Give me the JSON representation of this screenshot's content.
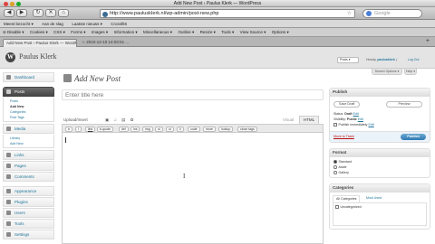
{
  "window": {
    "title": "Add New Post ‹ Paulus Klerk — WordPress"
  },
  "nav": {
    "back": "◀",
    "forward": "▶",
    "reload": "↻",
    "stop": "✕",
    "home": "⌂",
    "url": "http://www.pauluskIerk.nl/wp-admin/post-new.php",
    "search_placeholder": "Google"
  },
  "bookmarks": [
    "Meest bezocht ▾",
    "Aan de slag",
    "Laatste nieuws ▾",
    "Crossfit6"
  ],
  "devbar": [
    "⊘ Disable ▾",
    "Cookies ▾",
    "CSS ▾",
    "Forms ▾",
    "Images ▾",
    "Information ▾",
    "Miscellaneous ▾",
    "Outline ▾",
    "Resize ▾",
    "Tools ▾",
    "View Source ▾",
    "Options ▾"
  ],
  "tabs": {
    "active": "Add New Post ‹ Paulus Klerk — WordPress",
    "second": "☆ 2010-12-10 14:03:51 ..."
  },
  "wp": {
    "site_name": "Paulus Klerk",
    "posts_dropdown": "Posts ▾",
    "howdy_prefix": "Howdy,",
    "username": "pauluskIerk",
    "logout": "Log Out",
    "screen_options": "Screen Options ▾",
    "help": "Help ▾"
  },
  "sidebar": {
    "dashboard": "Dashboard",
    "posts": "Posts",
    "posts_sub": [
      "Posts",
      "Add New",
      "Categories",
      "Post Tags"
    ],
    "media": "Media",
    "media_sub": [
      "Library",
      "Add New"
    ],
    "links": "Links",
    "pages": "Pages",
    "comments": "Comments",
    "appearance": "Appearance",
    "plugins": "Plugins",
    "users": "Users",
    "tools": "Tools",
    "settings": "Settings"
  },
  "editor": {
    "heading": "Add New Post",
    "title_placeholder": "Enter title here",
    "upload_insert": "Upload/Insert",
    "upload_icons": "▣ ♫ ▤ ✿",
    "tab_visual": "Visual",
    "tab_html": "HTML",
    "quicktags": [
      "b",
      "i",
      "link",
      "b-quote",
      "del",
      "ins",
      "img",
      "ul",
      "ol",
      "li",
      "code",
      "more",
      "lookup",
      "close tags"
    ]
  },
  "publish": {
    "title": "Publish",
    "save_draft": "Save Draft",
    "preview": "Preview",
    "status_label": "Status:",
    "status_value": "Draft",
    "status_edit": "Edit",
    "visibility_label": "Visibility:",
    "visibility_value": "Public",
    "visibility_edit": "Edit",
    "publish_immediately": "Publish immediately",
    "publish_edit": "Edit",
    "move_to_trash": "Move to Trash",
    "publish_button": "Publish"
  },
  "format": {
    "title": "Format",
    "options": [
      "Standard",
      "Aside",
      "Gallery"
    ],
    "selected": 0
  },
  "categories": {
    "title": "Categories",
    "tab_all": "All Categories",
    "tab_used": "Most Used",
    "items": [
      "Uncategorized"
    ]
  }
}
